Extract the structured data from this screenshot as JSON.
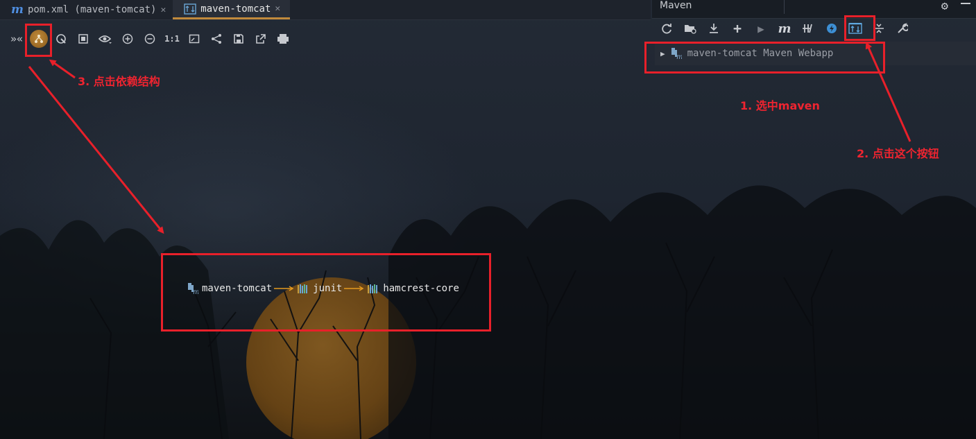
{
  "editor": {
    "tabs": [
      {
        "label": "pom.xml (maven-tomcat)",
        "icon": "maven-m-icon",
        "active": false
      },
      {
        "label": "maven-tomcat",
        "icon": "diagram-icon",
        "active": true
      }
    ]
  },
  "diagram_toolbar": {
    "items": [
      "expand-icon",
      "dependency-structure-icon",
      "navigate-icon",
      "fit-content-icon",
      "visibility-icon",
      "zoom-in-icon",
      "zoom-out-icon",
      "actual-size-icon",
      "fit-icon",
      "layout-icon",
      "save-icon",
      "export-icon",
      "print-icon"
    ],
    "actual_size_label": "1:1"
  },
  "maven_panel": {
    "title": "Maven",
    "toolbar_items": [
      "reload-icon",
      "add-project-icon",
      "download-icon",
      "plus-icon",
      "run-icon",
      "maven-goal-icon",
      "skip-tests-icon",
      "offline-icon",
      "show-dependencies-icon",
      "collapse-all-icon",
      "settings-wrench-icon"
    ],
    "maven_goal_label": "m",
    "project": "maven-tomcat Maven Webapp"
  },
  "dependency_diagram": {
    "nodes": [
      "maven-tomcat",
      "junit",
      "hamcrest-core"
    ]
  },
  "annotations": {
    "step1": "1. 选中maven",
    "step2": "2. 点击这个按钮",
    "step3": "3. 点击依赖结构"
  },
  "colors": {
    "annotation_red": "#e8202a",
    "edge_orange": "#e59a1f",
    "tab_underline": "#c18a3c"
  }
}
